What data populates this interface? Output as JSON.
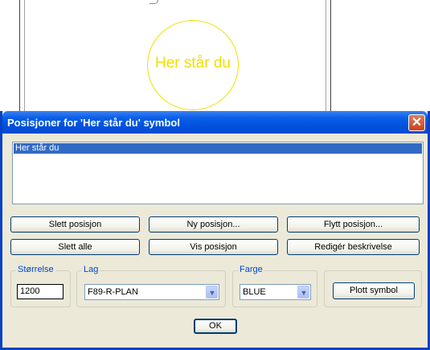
{
  "canvas": {
    "symbol_text": "Her står du",
    "symbol_color": "#f0e000"
  },
  "dialog": {
    "title": "Posisjoner for 'Her står du' symbol",
    "close_glyph": "✕",
    "list": {
      "items": [
        "Her står du"
      ],
      "selected_index": 0
    },
    "buttons": {
      "delete_position": "Slett posisjon",
      "new_position": "Ny posisjon...",
      "move_position": "Flytt posisjon...",
      "delete_all": "Slett alle",
      "show_position": "Vis posisjon",
      "edit_description": "Redigér beskrivelse",
      "plot_symbol": "Plott symbol",
      "ok": "OK"
    },
    "size_group": {
      "label": "Størrelse",
      "value": "1200"
    },
    "layer_group": {
      "label": "Lag",
      "value": "F89-R-PLAN"
    },
    "color_group": {
      "label": "Farge",
      "value": "BLUE"
    }
  },
  "colors": {
    "titlebar": "#0a5fe8",
    "selection": "#316ac5",
    "group_label": "#0046d5",
    "dialog_bg": "#ece9d8"
  }
}
